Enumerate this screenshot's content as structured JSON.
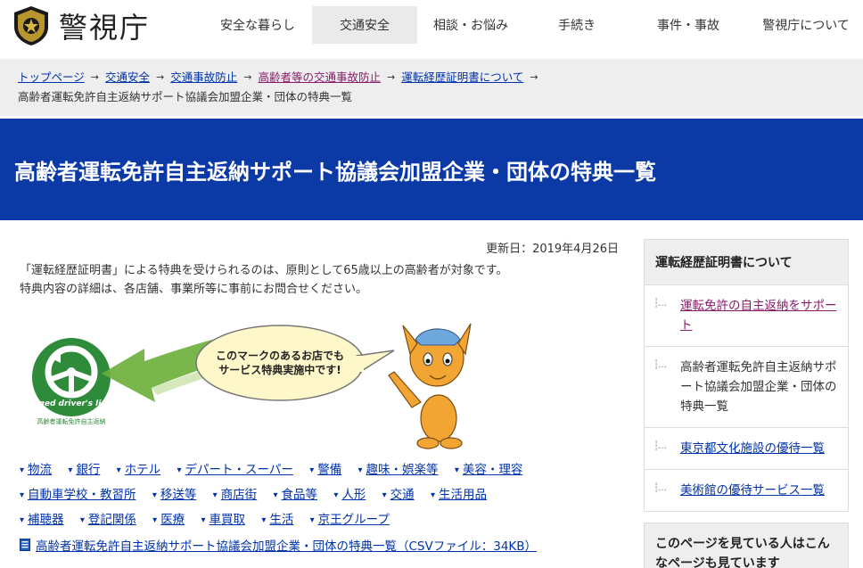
{
  "header": {
    "site_name": "警視庁",
    "nav": [
      {
        "label": "安全な暮らし",
        "active": false
      },
      {
        "label": "交通安全",
        "active": true
      },
      {
        "label": "相談・お悩み",
        "active": false
      },
      {
        "label": "手続き",
        "active": false
      },
      {
        "label": "事件・事故",
        "active": false
      },
      {
        "label": "警視庁について",
        "active": false
      }
    ]
  },
  "breadcrumb": {
    "items": [
      "トップページ",
      "交通安全",
      "交通事故防止",
      "高齢者等の交通事故防止",
      "運転経歴証明書について"
    ],
    "current": "高齢者運転免許自主返納サポート協議会加盟企業・団体の特典一覧"
  },
  "page": {
    "title": "高齢者運転免許自主返納サポート協議会加盟企業・団体の特典一覧",
    "updated": "更新日：2019年4月26日",
    "intro": [
      "「運転経歴証明書」による特典を受けられるのは、原則として65歳以上の高齢者が対象です。",
      "特典内容の詳細は、各店舗、事業所等に事前にお問合せください。"
    ],
    "bubble": [
      "このマークのあるお店でも",
      "サービス特典実施中です!"
    ],
    "mark_text": "the aged driver's license",
    "mark_subtext": "高齢者運転免許自主返納",
    "categories": [
      [
        "物流",
        "銀行",
        "ホテル",
        "デパート・スーパー",
        "警備",
        "趣味・娯楽等",
        "美容・理容"
      ],
      [
        "自動車学校・教習所",
        "移送等",
        "商店街",
        "食品等",
        "人形",
        "交通",
        "生活用品"
      ],
      [
        "補聴器",
        "登記関係",
        "医療",
        "車買取",
        "生活",
        "京王グループ"
      ]
    ],
    "csv_link": "高齢者運転免許自主返納サポート協議会加盟企業・団体の特典一覧（CSVファイル：34KB）"
  },
  "sidebar": {
    "heading": "運転経歴証明書について",
    "items": [
      {
        "label": "運転免許の自主返納をサポート",
        "state": "visited"
      },
      {
        "label": "高齢者運転免許自主返納サポート協議会加盟企業・団体の特典一覧",
        "state": "current"
      },
      {
        "label": "東京都文化施設の優待一覧",
        "state": "link"
      },
      {
        "label": "美術館の優待サービス一覧",
        "state": "link"
      }
    ],
    "also_viewed": "このページを見ている人はこんなページも見ています"
  },
  "colors": {
    "brand_blue": "#0b3aa6",
    "link": "#0033aa",
    "visited": "#8a1c6b",
    "mark_green": "#2e8b3a"
  }
}
